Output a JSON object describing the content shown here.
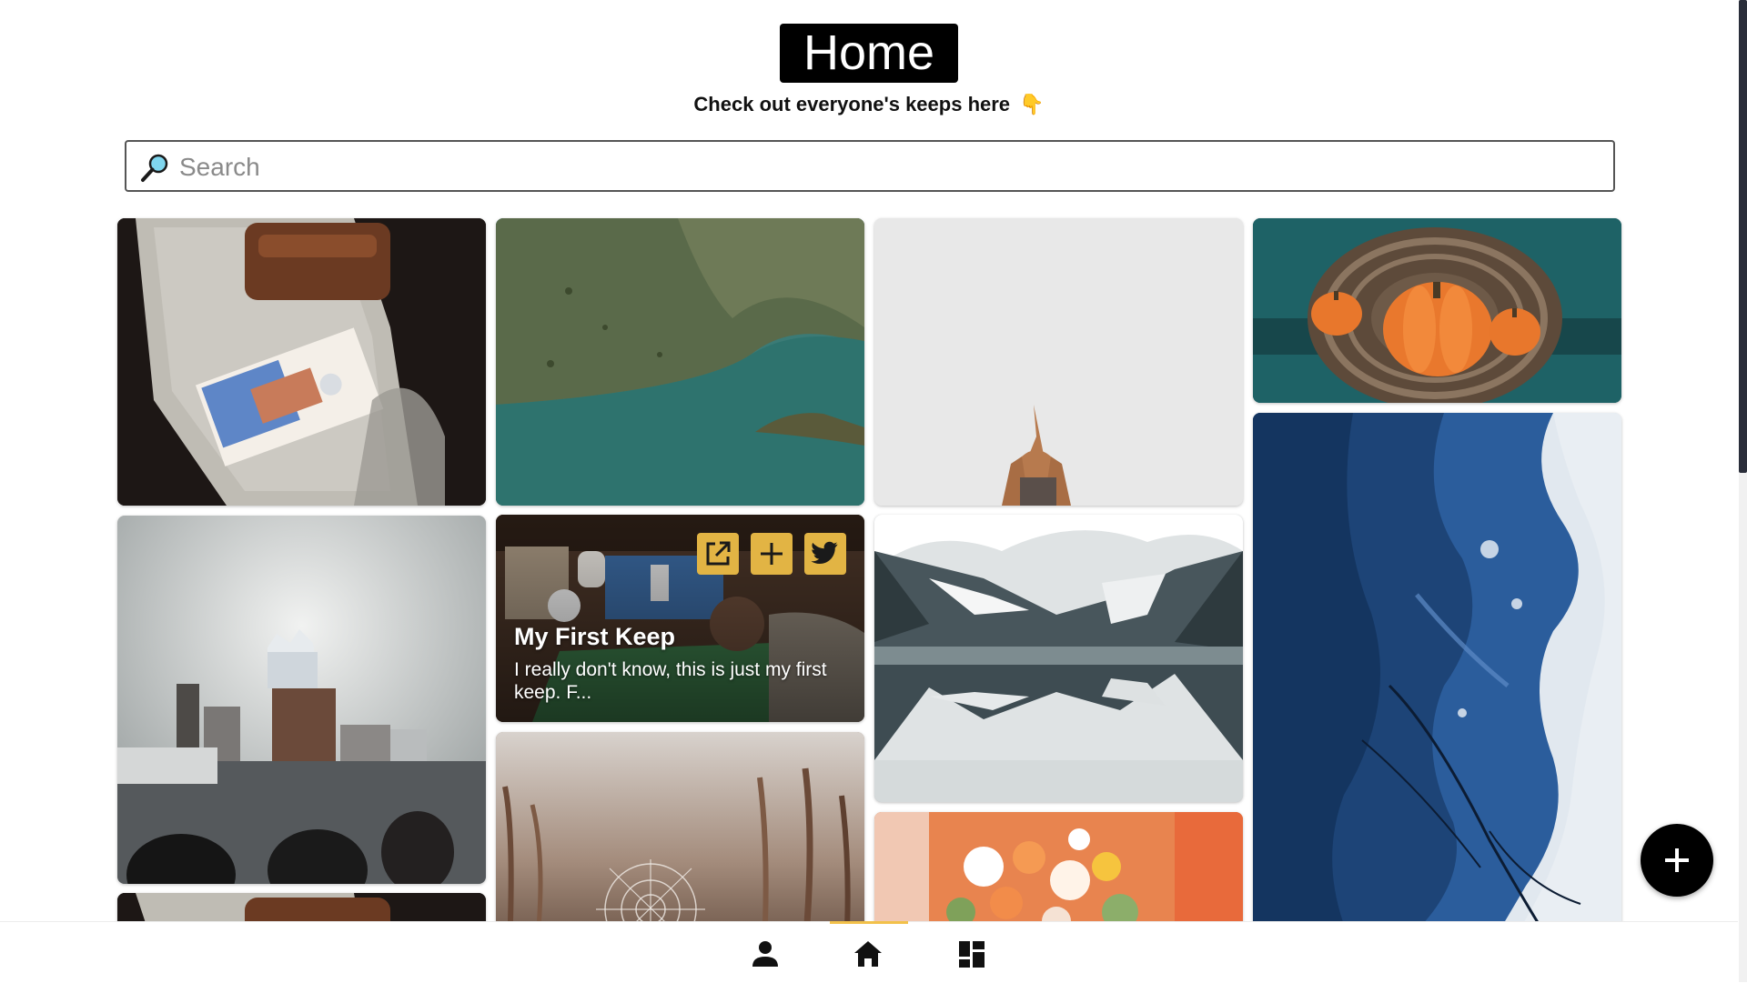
{
  "header": {
    "title": "Home",
    "subtitle": "Check out everyone's keeps here"
  },
  "search": {
    "placeholder": "Search"
  },
  "keep_card": {
    "title": "My First Keep",
    "description": "I really don't know, this is just my first keep. F..."
  },
  "colors": {
    "accent": "#e2b444",
    "nav_active": "#f2c14a",
    "title_bg": "#000000"
  },
  "icons": {
    "search": "magnifier-icon",
    "open": "open-external-icon",
    "add": "plus-icon",
    "share": "twitter-icon",
    "fab": "plus-icon",
    "nav_profile": "person-icon",
    "nav_home": "home-icon",
    "nav_vaults": "dashboard-icon"
  },
  "nav": {
    "active": "home"
  }
}
